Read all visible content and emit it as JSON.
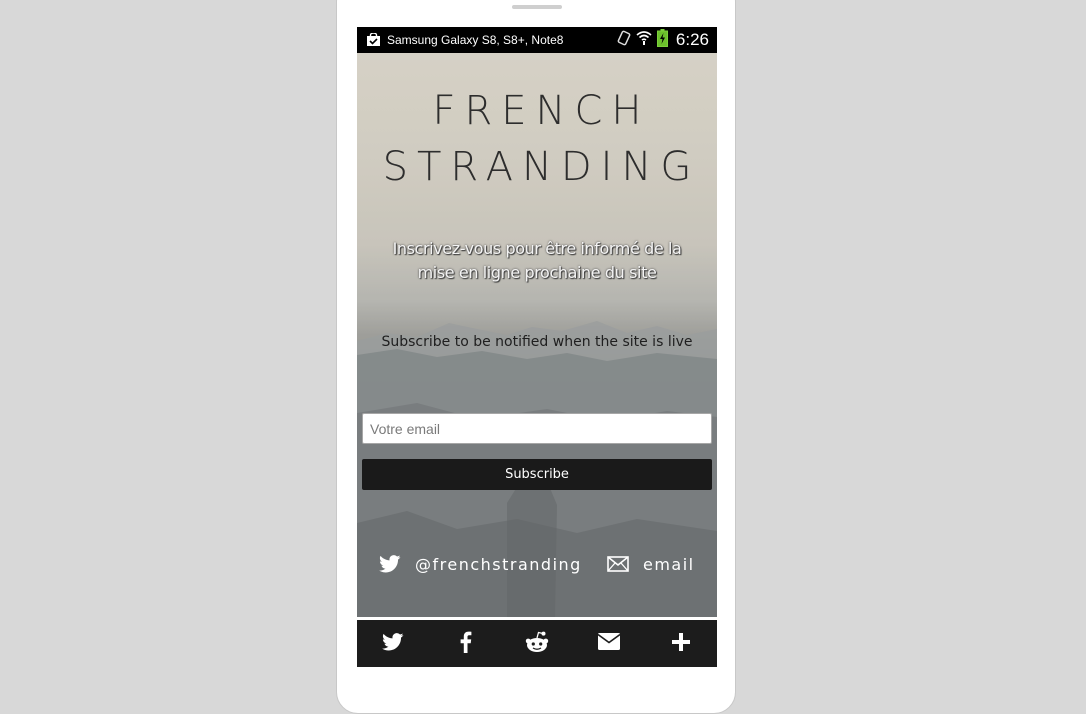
{
  "device": {
    "status_bar": {
      "device_name": "Samsung Galaxy S8, S8+, Note8",
      "time": "6:26"
    }
  },
  "page": {
    "title_line1": "FRENCH",
    "title_line2": "STRANDING",
    "subtitle_fr": "Inscrivez-vous pour être informé de la mise en ligne prochaine du site",
    "subtitle_en": "Subscribe to be notified when the site is live",
    "email_placeholder": "Votre email",
    "subscribe_label": "Subscribe",
    "twitter_handle": "@frenchstranding",
    "email_label": "email"
  },
  "share_bar": {
    "items": [
      "twitter-icon",
      "facebook-icon",
      "reddit-icon",
      "mail-icon",
      "plus-icon"
    ]
  },
  "colors": {
    "page_background": "#d8d8d8",
    "share_bar": "#1c1c1c",
    "button": "#1a1a1a"
  }
}
